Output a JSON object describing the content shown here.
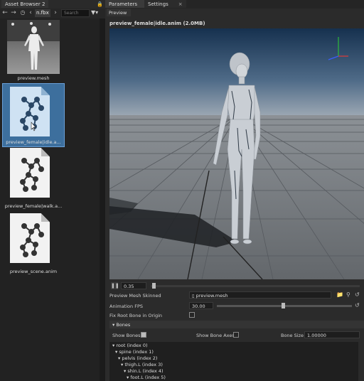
{
  "left_panel": {
    "tab_title": "Asset Browser 2",
    "path": "n.fbx",
    "search_placeholder": "Search",
    "assets": [
      {
        "label": "preview.mesh",
        "type": "mesh",
        "selected": false
      },
      {
        "label": "preview_female|idle.a...",
        "type": "anim",
        "selected": true
      },
      {
        "label": "preview_female|walk.a...",
        "type": "anim",
        "selected": false
      },
      {
        "label": "preview_scene.anim",
        "type": "anim",
        "selected": false
      }
    ]
  },
  "right_panel": {
    "tabs": [
      {
        "label": "Parameters"
      },
      {
        "label": "Settings"
      }
    ],
    "subtab": "Preview",
    "title": "preview_female|idle.anim (2.0MB)",
    "timeline_value": "0.35",
    "mesh_label": "Preview Mesh Skinned",
    "mesh_value": "preview.mesh",
    "fps_label": "Animation FPS",
    "fps_value": "30.00",
    "fps_slider_fraction": 0.49,
    "fix_root_label": "Fix Root Bone in Origin",
    "bones_header": "Bones",
    "show_bones_label": "Show Bones",
    "show_bone_axes_label": "Show Bone Axes",
    "bone_size_label": "Bone Size",
    "bone_size_value": "1.00000",
    "bones": [
      "root (index 0)",
      "spine (index 1)",
      "pelvis (index 2)",
      "thigh.L (index 3)",
      "shin.L (index 4)",
      "foot.L (index 5)"
    ]
  },
  "colors": {
    "selection": "#3d6f9d",
    "sky_top": "#16314f",
    "floor": "#767a7f"
  }
}
